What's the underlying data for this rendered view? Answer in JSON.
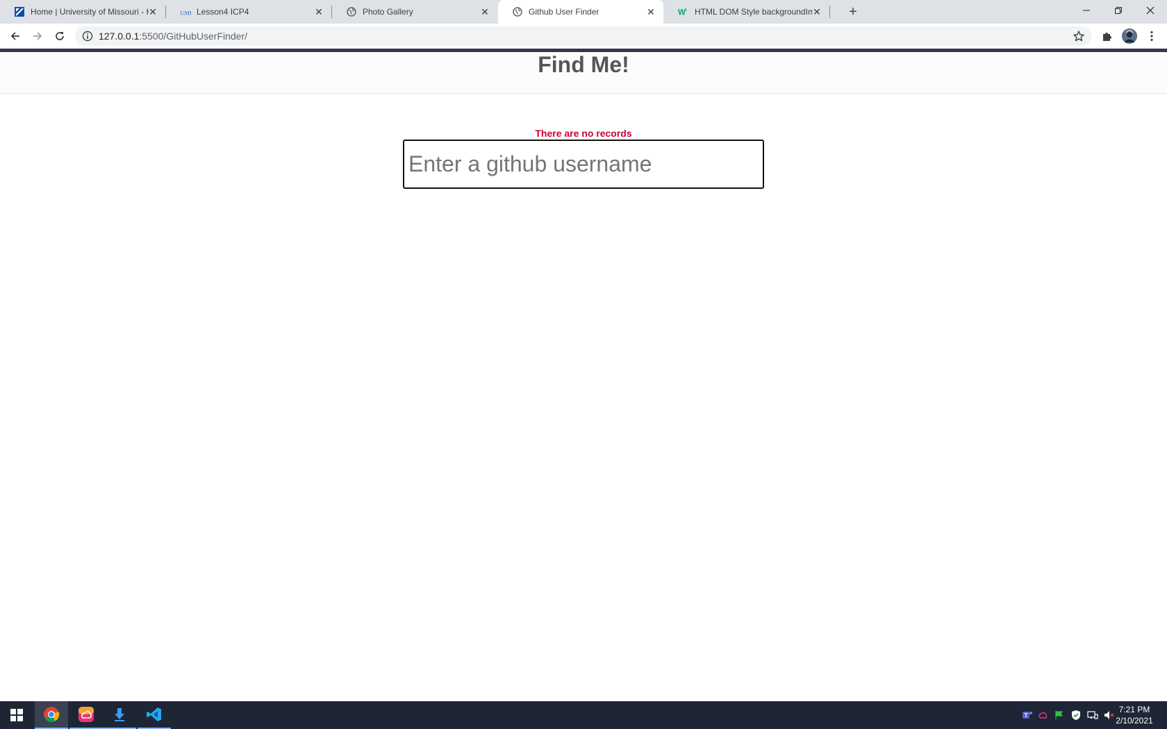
{
  "browser": {
    "tabs": [
      {
        "title": "Home | University of Missouri - K",
        "icon": "umkc-logo-icon",
        "active": false
      },
      {
        "title": "Lesson4 ICP4",
        "icon": "umkc-text-icon",
        "active": false
      },
      {
        "title": "Photo Gallery",
        "icon": "globe-icon",
        "active": false
      },
      {
        "title": "Github User Finder",
        "icon": "globe-icon",
        "active": true
      },
      {
        "title": "HTML DOM Style backgroundIm",
        "icon": "w3schools-icon",
        "active": false
      }
    ],
    "url_host": "127.0.0.1",
    "url_rest": ":5500/GitHubUserFinder/"
  },
  "page": {
    "heading": "Find Me!",
    "message": "There are no records",
    "search_placeholder": "Enter a github username",
    "accent_color": "#3c3150",
    "message_color": "#cc0033"
  },
  "taskbar": {
    "apps": [
      "chrome-icon",
      "creative-cloud-icon",
      "download-icon",
      "vscode-icon"
    ],
    "time": "7:21 PM",
    "date": "2/10/2021"
  }
}
